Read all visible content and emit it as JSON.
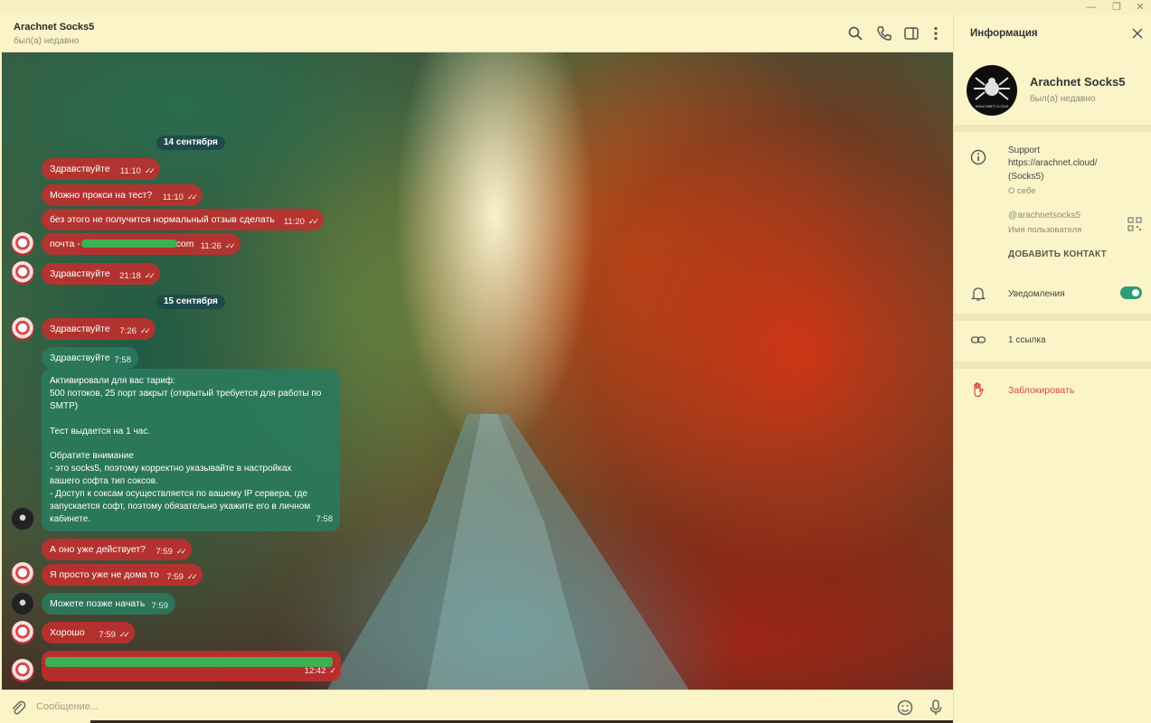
{
  "window": {
    "minimize": "—",
    "maximize": "❐",
    "close": "✕"
  },
  "chat_header": {
    "title": "Arachnet Socks5",
    "status": "был(а) недавно",
    "icons": [
      "search-icon",
      "phone-icon",
      "sidebar-toggle-icon",
      "more-vertical-icon"
    ]
  },
  "dates": [
    "14 сентября",
    "15 сентября"
  ],
  "messages": [
    {
      "text": "Здравствуйте",
      "time": "11:10",
      "dir": "out",
      "read": true
    },
    {
      "text": "Можно прокси на тест?",
      "time": "11:10",
      "dir": "out",
      "read": true
    },
    {
      "text": "без этого не получится нормальный отзыв сделать",
      "time": "11:20",
      "dir": "out",
      "read": true
    },
    {
      "text": "почта - ",
      "suffix": "com",
      "time": "11:26",
      "dir": "out",
      "read": true,
      "redacted": true
    },
    {
      "text": "Здравствуйте",
      "time": "21:18",
      "dir": "out",
      "read": true
    },
    {
      "text": "Здравствуйте",
      "time": "7:26",
      "dir": "out",
      "read": true
    },
    {
      "text": "Здравствуйте",
      "time": "7:58",
      "dir": "in"
    },
    {
      "text": "А оно уже действует?",
      "time": "7:59",
      "dir": "out",
      "read": true
    },
    {
      "text": "Я просто уже не дома то",
      "time": "7:59",
      "dir": "out",
      "read": true
    },
    {
      "text": "Можете позже начать",
      "time": "7:59",
      "dir": "in"
    },
    {
      "text": "Хорошо",
      "time": "7:59",
      "dir": "out",
      "read": true
    },
    {
      "text": "",
      "time": "12:42",
      "dir": "out",
      "read": false,
      "redacted": true
    }
  ],
  "long_message": {
    "lines": [
      "Активировали для вас тариф:",
      "500 потоков, 25 порт закрыт (открытый требуется для работы по",
      "SMTP)",
      "",
      "Тест выдается на 1 час.",
      "",
      "Обратите внимание",
      "- это socks5, поэтому корректно указывайте в настройках",
      "вашего софта тип соксов.",
      "- Доступ к соксам осуществляется по вашему IP сервера, где",
      "запускается софт, поэтому обязательно укажите его в личном",
      "кабинете."
    ],
    "time": "7:58"
  },
  "composer": {
    "placeholder": "Сообщение..."
  },
  "info_panel": {
    "title": "Информация",
    "profile_name": "Arachnet Socks5",
    "profile_status": "был(а) недавно",
    "avatar_label": "ARACHNET.CLOUD",
    "bio_lines": [
      "Support",
      "https://arachnet.cloud/",
      "(Socks5)"
    ],
    "bio_label": "О себе",
    "username": "@arachnetsocks5",
    "username_label": "Имя пользователя",
    "add_contact": "ДОБАВИТЬ КОНТАКТ",
    "notifications": "Уведомления",
    "notifications_on": true,
    "links": "1 ссылка",
    "block": "Заблокировать"
  },
  "colors": {
    "outgoing_bubble": "#c42e2e",
    "incoming_bubble": "#2a7a5c",
    "date_pill": "#1e464b",
    "panel_bg": "#fbf4c8",
    "toggle_on": "#2e9c7a",
    "danger": "#d04848"
  }
}
